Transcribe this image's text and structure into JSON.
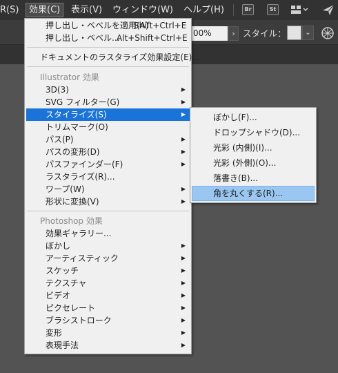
{
  "menubar": {
    "partial_label": "R(S)",
    "effect_label": "効果(C)",
    "view_label": "表示(V)",
    "window_label": "ウィンドウ(W)",
    "help_label": "ヘルプ(H)",
    "bridge_label": "Br",
    "stock_label": "St"
  },
  "controlbar": {
    "opacity_value": "00%",
    "style_label": "スタイル："
  },
  "effect_menu": {
    "apply_last": "押し出し・ベベルを適用(A)",
    "apply_last_shortcut": "Shift+Ctrl+E",
    "last_effect": "押し出し・ベベル...",
    "last_effect_shortcut": "Alt+Shift+Ctrl+E",
    "raster_settings": "ドキュメントのラスタライズ効果設定(E)...",
    "illustrator_header": "Illustrator 効果",
    "illustrator_items": [
      "3D(3)",
      "SVG フィルター(G)",
      "スタイライズ(S)",
      "トリムマーク(O)",
      "パス(P)",
      "パスの変形(D)",
      "パスファインダー(F)",
      "ラスタライズ(R)...",
      "ワープ(W)",
      "形状に変換(V)"
    ],
    "photoshop_header": "Photoshop 効果",
    "photoshop_items": [
      "効果ギャラリー...",
      "ぼかし",
      "アーティスティック",
      "スケッチ",
      "テクスチャ",
      "ビデオ",
      "ピクセレート",
      "ブラシストローク",
      "変形",
      "表現手法"
    ]
  },
  "stylize_submenu": {
    "items": [
      "ぼかし(F)...",
      "ドロップシャドウ(D)...",
      "光彩 (内側)(I)...",
      "光彩 (外側)(O)...",
      "落書き(B)...",
      "角を丸くする(R)..."
    ]
  },
  "colors": {
    "selection": "#1a73d9",
    "hover": "#99c7f1",
    "menu_bg": "#f0f0f0",
    "app_bg": "#535353"
  }
}
